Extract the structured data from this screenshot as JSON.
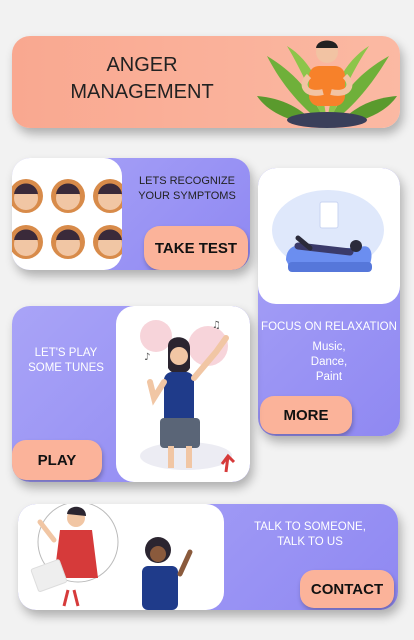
{
  "header": {
    "title_line1": "ANGER",
    "title_line2": "MANAGEMENT"
  },
  "symptoms": {
    "text_line1": "LETS RECOGNIZE",
    "text_line2": "YOUR SYMPTOMS",
    "button": "TAKE TEST"
  },
  "relax": {
    "title": "FOCUS ON RELAXATION",
    "items": [
      "Music,",
      "Dance,",
      "Paint"
    ],
    "button": "MORE"
  },
  "tunes": {
    "text_line1": "LET'S PLAY",
    "text_line2": "SOME TUNES",
    "button": "PLAY"
  },
  "talk": {
    "text_line1": "TALK TO SOMEONE,",
    "text_line2": "TALK TO US",
    "button": "CONTACT"
  },
  "colors": {
    "peach": "#fbb39a",
    "lavender": "#958ef3",
    "background": "#f2f2f2"
  }
}
